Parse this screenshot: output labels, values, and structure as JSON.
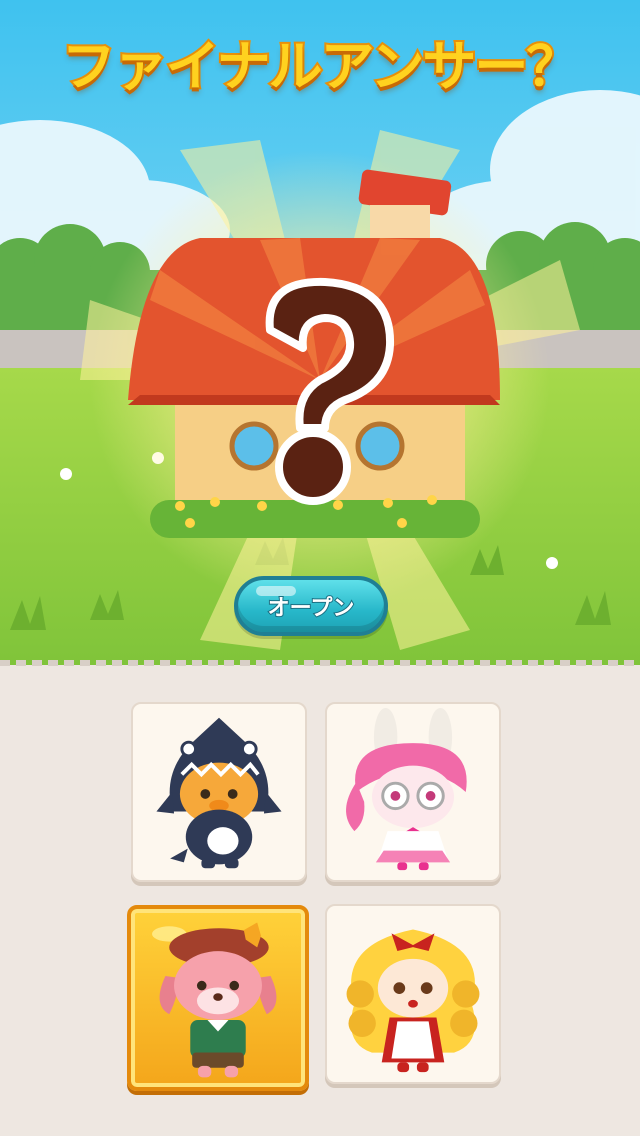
{
  "title": "ファイナルアンサー？",
  "open_button": {
    "label": "オープン"
  },
  "cards": [
    {
      "name": "penguin-dinosaur-costume"
    },
    {
      "name": "pink-haired-bunny-glasses"
    },
    {
      "name": "dog-beret-green-shirt",
      "selected": true
    },
    {
      "name": "blonde-girl-red-bow"
    }
  ],
  "colors": {
    "title_fill": "#ffd21f",
    "button": "#27b7c9",
    "selected_card": "#f4a61b"
  },
  "icons": {
    "mystery": "question-mark-icon"
  }
}
